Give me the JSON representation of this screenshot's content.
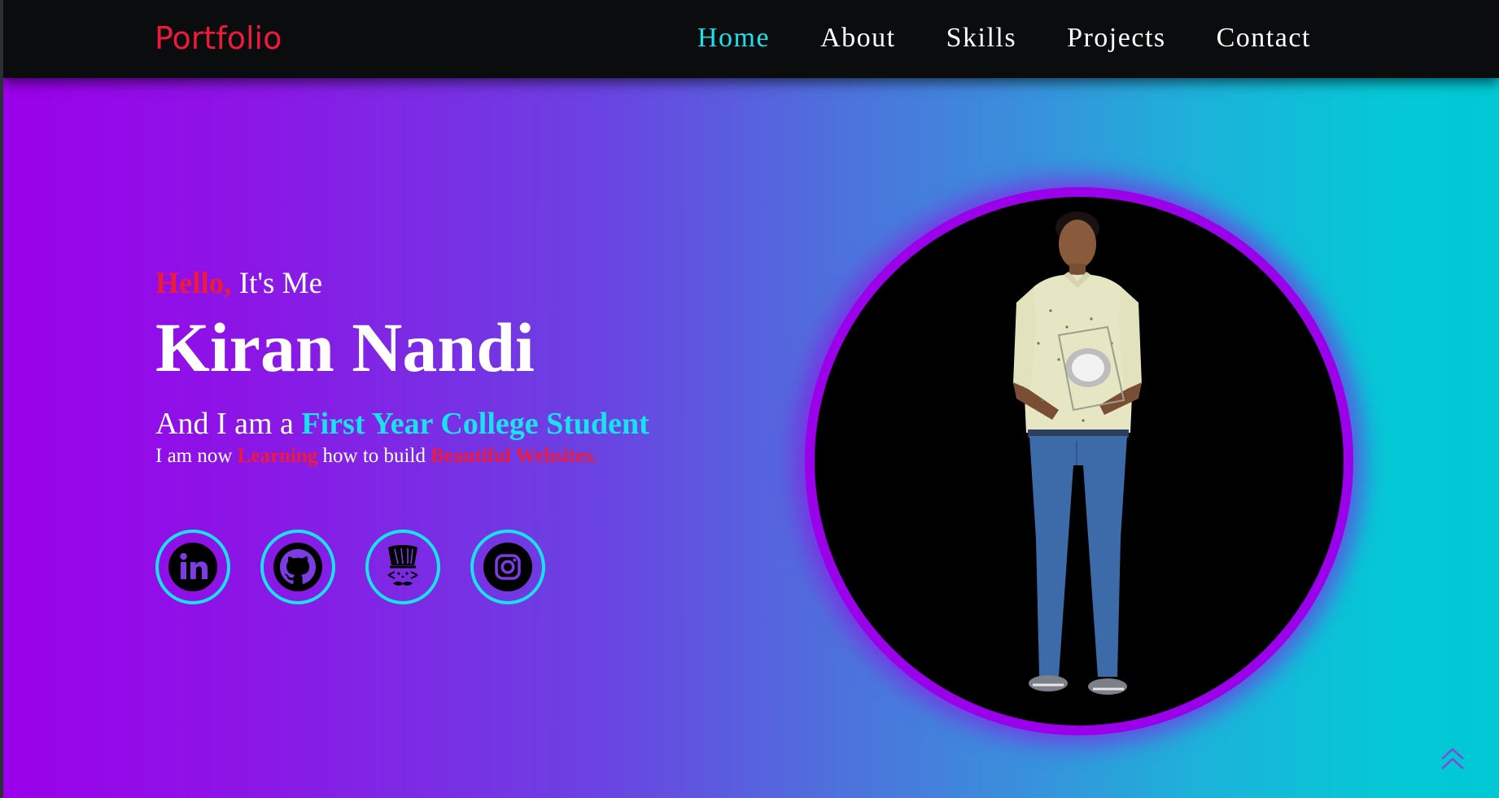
{
  "nav": {
    "brand": "Portfolio",
    "links": [
      {
        "label": "Home",
        "active": true
      },
      {
        "label": "About",
        "active": false
      },
      {
        "label": "Skills",
        "active": false
      },
      {
        "label": "Projects",
        "active": false
      },
      {
        "label": "Contact",
        "active": false
      }
    ]
  },
  "hero": {
    "greeting_accent": "Hello,",
    "greeting_rest": " It's Me",
    "name": "Kiran Nandi",
    "role_prefix": "And I am a ",
    "role": "First Year College Student",
    "desc_1": "I am now ",
    "desc_accent_1": "Learning",
    "desc_2": " how to build ",
    "desc_accent_2": "Beautiful Websites."
  },
  "socials": [
    {
      "icon": "linkedin-icon"
    },
    {
      "icon": "github-icon"
    },
    {
      "icon": "codechef-icon"
    },
    {
      "icon": "instagram-icon"
    }
  ],
  "photo": {
    "icon": "profile-photo"
  },
  "scroll_top": {
    "icon": "double-chevron-up-icon"
  },
  "colors": {
    "accent_red": "#ee1a3c",
    "accent_cyan": "#19e2ee",
    "gradient_start": "#9b00ea",
    "gradient_end": "#00c9d6",
    "navbar_bg": "#0b0c0d"
  }
}
